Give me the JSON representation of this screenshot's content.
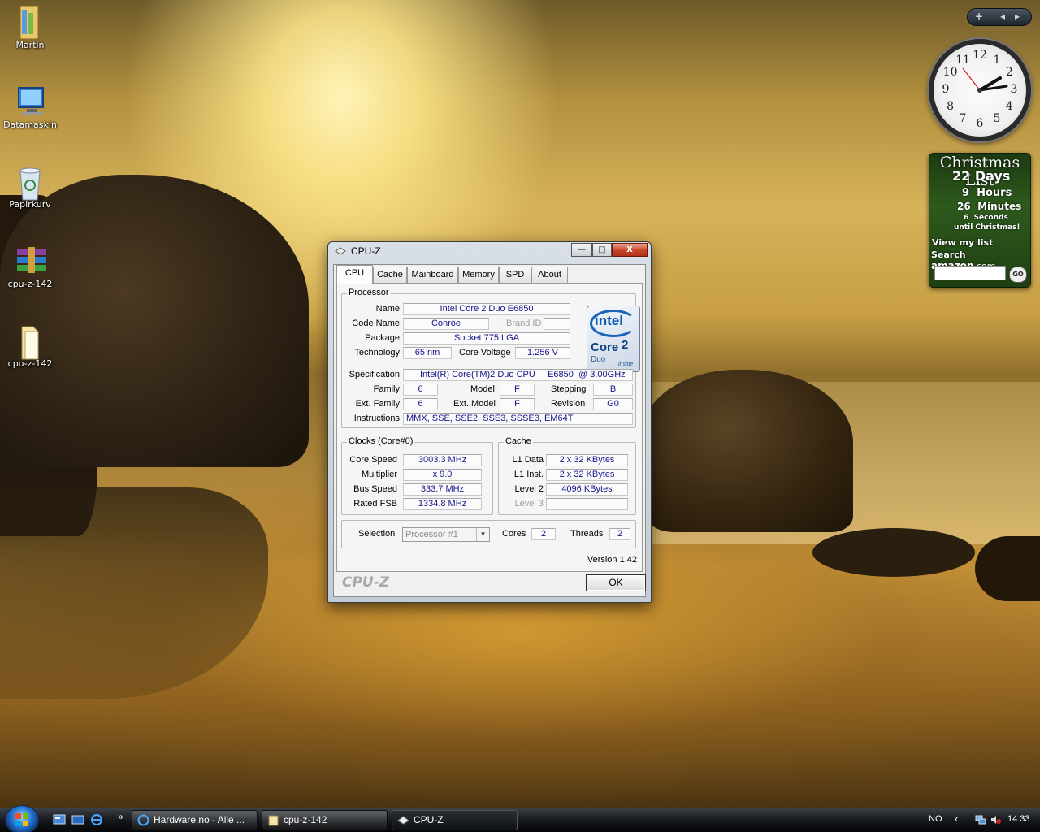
{
  "desktop": {
    "icons": [
      {
        "label": "Martin"
      },
      {
        "label": "Datamaskin"
      },
      {
        "label": "Papirkurv"
      },
      {
        "label": "cpu-z-142"
      },
      {
        "label": "cpu-z-142"
      }
    ]
  },
  "gadgets": {
    "controls": {
      "add": "+",
      "prev": "◂",
      "next": "▸"
    },
    "clock": {
      "numbers": [
        "12",
        "1",
        "2",
        "3",
        "4",
        "5",
        "6",
        "7",
        "8",
        "9",
        "10",
        "11"
      ],
      "time": "14:33"
    },
    "christmas": {
      "title": "Christmas List",
      "days_value": "22",
      "days_label": "Days",
      "hours_value": "9",
      "hours_label": "Hours",
      "minutes_value": "26",
      "minutes_label": "Minutes",
      "seconds_value": "6",
      "seconds_label": "Seconds",
      "until": "until Christmas!",
      "view_list": "View my list",
      "search_prefix": "Search",
      "search_brand": "amazon",
      "search_suffix": ".com",
      "go_label": "GO"
    }
  },
  "cpuz": {
    "title": "CPU-Z",
    "window_controls": {
      "minimize": "—",
      "maximize": "□",
      "close": "X"
    },
    "tabs": [
      "CPU",
      "Cache",
      "Mainboard",
      "Memory",
      "SPD",
      "About"
    ],
    "processor": {
      "group_label": "Processor",
      "name_label": "Name",
      "name": "Intel Core 2 Duo E6850",
      "codename_label": "Code Name",
      "codename": "Conroe",
      "brandid_label": "Brand ID",
      "brandid": "",
      "package_label": "Package",
      "package": "Socket 775 LGA",
      "technology_label": "Technology",
      "technology": "65 nm",
      "corevoltage_label": "Core Voltage",
      "corevoltage": "1.256 V",
      "spec_label": "Specification",
      "spec": "Intel(R) Core(TM)2 Duo CPU     E6850  @ 3.00GHz",
      "family_label": "Family",
      "family": "6",
      "model_label": "Model",
      "model": "F",
      "stepping_label": "Stepping",
      "stepping": "B",
      "extfamily_label": "Ext. Family",
      "extfamily": "6",
      "extmodel_label": "Ext. Model",
      "extmodel": "F",
      "revision_label": "Revision",
      "revision": "G0",
      "instructions_label": "Instructions",
      "instructions": "MMX, SSE, SSE2, SSE3, SSSE3, EM64T"
    },
    "logo": {
      "brand": "intel",
      "product": "Core",
      "product_num": "2",
      "sub": "Duo",
      "inside": "inside"
    },
    "clocks": {
      "group_label": "Clocks (Core#0)",
      "corespeed_label": "Core Speed",
      "corespeed": "3003.3 MHz",
      "multiplier_label": "Multiplier",
      "multiplier": "x 9.0",
      "busspeed_label": "Bus Speed",
      "busspeed": "333.7 MHz",
      "ratedfsb_label": "Rated FSB",
      "ratedfsb": "1334.8 MHz"
    },
    "cache": {
      "group_label": "Cache",
      "l1data_label": "L1 Data",
      "l1data": "2 x 32 KBytes",
      "l1inst_label": "L1 Inst.",
      "l1inst": "2 x 32 KBytes",
      "level2_label": "Level 2",
      "level2": "4096 KBytes",
      "level3_label": "Level 3",
      "level3": ""
    },
    "selection_label": "Selection",
    "selection_value": "Processor #1",
    "cores_label": "Cores",
    "cores": "2",
    "threads_label": "Threads",
    "threads": "2",
    "version": "Version 1.42",
    "brand_footer": "CPU-Z",
    "ok_label": "OK"
  },
  "taskbar": {
    "tasks": [
      {
        "label": "Hardware.no - Alle ..."
      },
      {
        "label": "cpu-z-142"
      },
      {
        "label": "CPU-Z"
      }
    ],
    "language": "NO",
    "chevron": "‹",
    "time": "14:33",
    "overflow": "»"
  }
}
